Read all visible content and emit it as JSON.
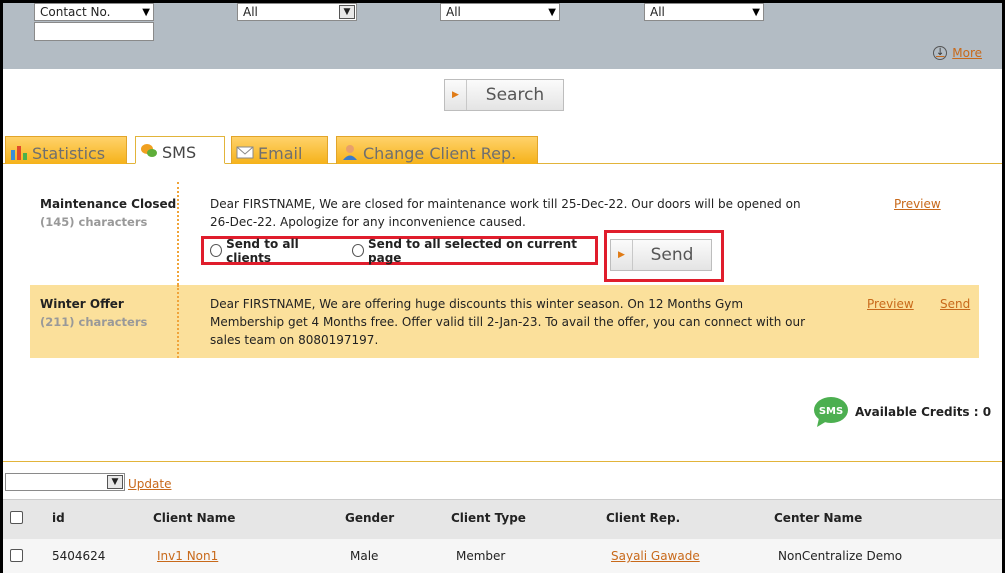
{
  "filters": {
    "contact_select": "Contact No.",
    "select2": "All",
    "select3": "All",
    "select4": "All",
    "more_label": "More"
  },
  "search_button": "Search",
  "tabs": [
    {
      "label": "Statistics"
    },
    {
      "label": "SMS"
    },
    {
      "label": "Email"
    },
    {
      "label": "Change Client Rep."
    }
  ],
  "templates": [
    {
      "name": "Maintenance Closed",
      "count": "(145) characters",
      "message": "Dear FIRSTNAME, We are closed for maintenance work till 25-Dec-22. Our doors will be opened on 26-Dec-22. Apologize for any inconvenience caused.",
      "preview": "Preview"
    },
    {
      "name": "Winter Offer",
      "count": "(211) characters",
      "message": "Dear FIRSTNAME, We are offering huge discounts this winter season. On 12 Months Gym Membership get 4 Months free. Offer valid till 2-Jan-23. To avail the offer, you can connect with our sales team on 8080197197.",
      "preview": "Preview",
      "send": "Send"
    }
  ],
  "send_options": {
    "all_clients": "Send to all clients",
    "selected_page": "Send to all selected on current page",
    "send_button": "Send"
  },
  "credits": {
    "bubble": "SMS",
    "label": "Available Credits : 0"
  },
  "bulk": {
    "update_label": "Update"
  },
  "table": {
    "headers": [
      "id",
      "Client Name",
      "Gender",
      "Client Type",
      "Client Rep.",
      "Center Name"
    ],
    "rows": [
      {
        "id": "5404624",
        "client_name": "Inv1 Non1",
        "gender": "Male",
        "client_type": "Member",
        "client_rep": "Sayali Gawade",
        "center": "NonCentralize Demo"
      }
    ]
  },
  "colors": {
    "accent": "#c8691a",
    "tab_bg": "#f5b21a",
    "highlight_row": "#fbe09b",
    "annotation_red": "#e01d2c"
  }
}
